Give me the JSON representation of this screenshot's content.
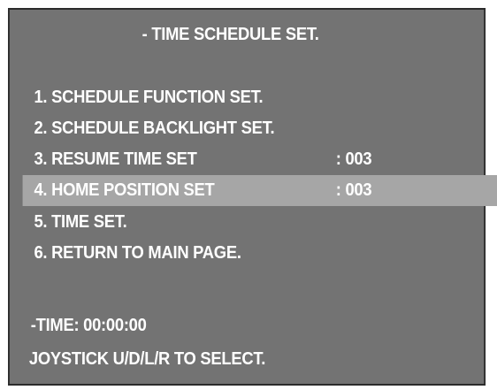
{
  "title": "- TIME SCHEDULE SET.",
  "menu": {
    "items": [
      {
        "label": "1. SCHEDULE FUNCTION SET.",
        "value": ""
      },
      {
        "label": "2. SCHEDULE BACKLIGHT SET.",
        "value": ""
      },
      {
        "label": "3. RESUME TIME SET",
        "value": ": 003"
      },
      {
        "label": "4. HOME POSITION SET",
        "value": ": 003"
      },
      {
        "label": "5. TIME SET.",
        "value": ""
      },
      {
        "label": "6. RETURN TO MAIN PAGE.",
        "value": ""
      }
    ],
    "selected_index": 3
  },
  "status": {
    "time": "-TIME: 00:00:00",
    "hint": "JOYSTICK U/D/L/R TO SELECT."
  },
  "colors": {
    "background": "#737373",
    "highlight": "#a6a6a6",
    "text": "#ffffff"
  }
}
